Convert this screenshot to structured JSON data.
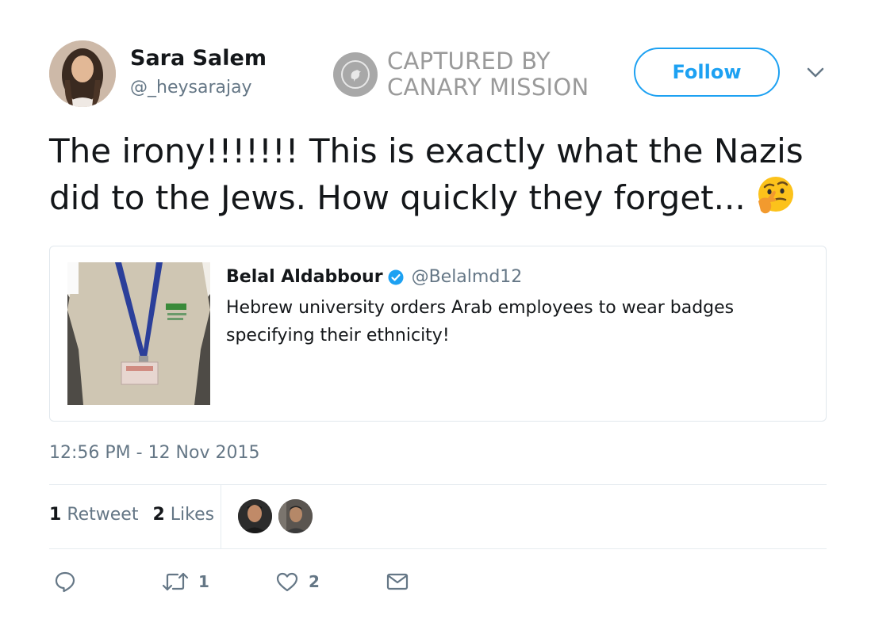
{
  "author": {
    "name": "Sara Salem",
    "handle": "@_heysarajay"
  },
  "watermark": {
    "line1": "CAPTURED BY",
    "line2": "CANARY MISSION"
  },
  "header": {
    "follow_label": "Follow",
    "menu_icon": "chevron-down-icon"
  },
  "tweet": {
    "line1": "The irony!!!!!!! This is exactly what the Nazis",
    "line2": "did to the Jews. How quickly they forget...",
    "emoji": "thinking-face-emoji"
  },
  "quoted": {
    "name": "Belal Aldabbour",
    "handle": "@Belalmd12",
    "verified": true,
    "line1": "Hebrew university orders Arab employees to wear badges",
    "line2": "specifying their ethnicity!"
  },
  "timestamp": "12:56 PM - 12 Nov 2015",
  "stats": {
    "retweets_count": "1",
    "retweets_label": "Retweet",
    "likes_count": "2",
    "likes_label": "Likes"
  },
  "actions": {
    "reply_icon": "reply-icon",
    "retweet_icon": "retweet-icon",
    "retweet_count": "1",
    "like_icon": "heart-icon",
    "like_count": "2",
    "dm_icon": "envelope-icon"
  },
  "colors": {
    "accent": "#1da1f2",
    "text": "#14171a",
    "muted": "#657786",
    "border": "#e1e8ed"
  }
}
